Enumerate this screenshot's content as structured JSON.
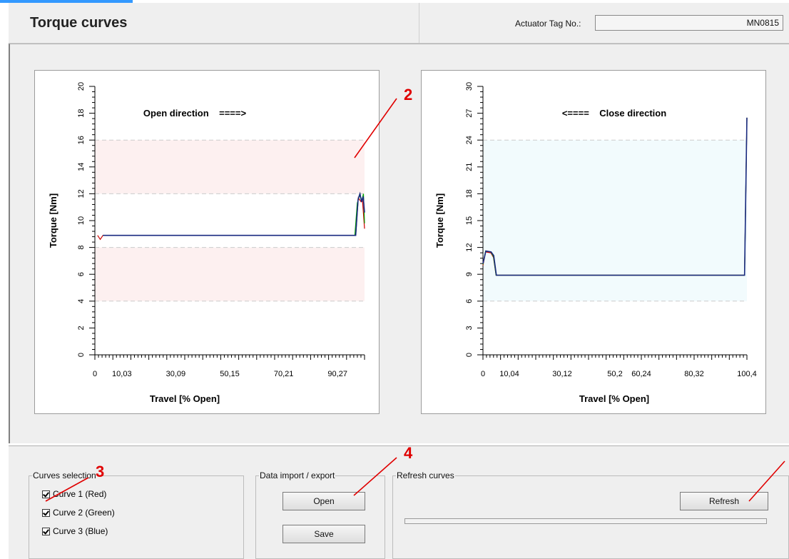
{
  "header": {
    "title": "Torque curves",
    "tag_label": "Actuator Tag No.:",
    "tag_value": "MN0815"
  },
  "charts": [
    {
      "title": "Open direction    ====>",
      "xlabel": "Travel  [% Open]",
      "ylabel": "Torque [Nm]"
    },
    {
      "title": "<====    Close direction",
      "xlabel": "Travel  [% Open]",
      "ylabel": "Torque [Nm]"
    }
  ],
  "chart_data": [
    {
      "type": "line",
      "title": "Open direction    ====>",
      "xlabel": "Travel  [% Open]",
      "ylabel": "Torque [Nm]",
      "xlim": [
        0,
        100.3
      ],
      "ylim": [
        0,
        20
      ],
      "x_ticks": [
        "0",
        "10,03",
        "30,09",
        "50,15",
        "70,21",
        "90,27"
      ],
      "y_ticks": [
        0,
        2,
        4,
        6,
        8,
        10,
        12,
        14,
        16,
        18,
        20
      ],
      "bands": [
        {
          "from": 12,
          "to": 16
        },
        {
          "from": 4,
          "to": 8
        }
      ],
      "band_color": "#fdf0f0",
      "series": [
        {
          "color": "#cc0000",
          "x": [
            1,
            2,
            3,
            97,
            98,
            99,
            99.5,
            100.3
          ],
          "y": [
            8.9,
            8.6,
            8.9,
            8.9,
            11.7,
            11.4,
            11.6,
            9.4
          ]
        },
        {
          "color": "#00a000",
          "x": [
            3,
            96.7,
            97.6,
            98.4,
            99.3,
            99.9,
            100.3
          ],
          "y": [
            8.9,
            8.9,
            11.3,
            11.9,
            11.5,
            12.0,
            9.8
          ]
        },
        {
          "color": "#1a2a80",
          "x": [
            3,
            97,
            97.9,
            98.6,
            99.2,
            99.8,
            100.3
          ],
          "y": [
            8.9,
            8.9,
            11.6,
            12.0,
            11.4,
            11.8,
            10.6
          ]
        }
      ]
    },
    {
      "type": "line",
      "title": "<====    Close direction",
      "xlabel": "Travel  [% Open]",
      "ylabel": "Torque [Nm]",
      "xlim": [
        0,
        100.4
      ],
      "ylim": [
        0,
        30
      ],
      "x_ticks": [
        "0",
        "10,04",
        "30,12",
        "50,2",
        "60,24",
        "80,32",
        "100,4"
      ],
      "y_ticks": [
        0,
        3,
        6,
        9,
        12,
        15,
        18,
        21,
        24,
        27,
        30
      ],
      "bands": [
        {
          "from": 6,
          "to": 24
        }
      ],
      "band_color": "#f2fbfd",
      "series": [
        {
          "color": "#cc0000",
          "x": [
            0,
            1,
            3,
            4,
            5,
            99.5,
            100.4
          ],
          "y": [
            10,
            11.5,
            11.4,
            10.9,
            8.9,
            8.9,
            26.5
          ]
        },
        {
          "color": "#00a000",
          "x": [
            0,
            1,
            3,
            4,
            5,
            99.5,
            100.4
          ],
          "y": [
            10.1,
            11.6,
            11.5,
            11.0,
            8.9,
            8.9,
            26.5
          ]
        },
        {
          "color": "#1a2a80",
          "x": [
            0,
            1.1,
            3.1,
            4.1,
            5.1,
            99.5,
            100.4
          ],
          "y": [
            10.2,
            11.6,
            11.5,
            11.1,
            8.9,
            8.9,
            26.5
          ]
        }
      ]
    }
  ],
  "curves_selection": {
    "legend": "Curves selection",
    "items": [
      {
        "label": "Curve 1 (Red)",
        "checked": true
      },
      {
        "label": "Curve 2 (Green)",
        "checked": true
      },
      {
        "label": "Curve 3 (Blue)",
        "checked": true
      }
    ]
  },
  "data_io": {
    "legend": "Data import / export",
    "open_label": "Open",
    "save_label": "Save"
  },
  "refresh": {
    "legend": "Refresh curves",
    "refresh_label": "Refresh",
    "progress": 0
  },
  "callouts": [
    "2",
    "3",
    "4"
  ],
  "colors": {
    "callout": "#e00000",
    "pink_band": "#fdf0f0",
    "cyan_band": "#f2fbfd"
  }
}
